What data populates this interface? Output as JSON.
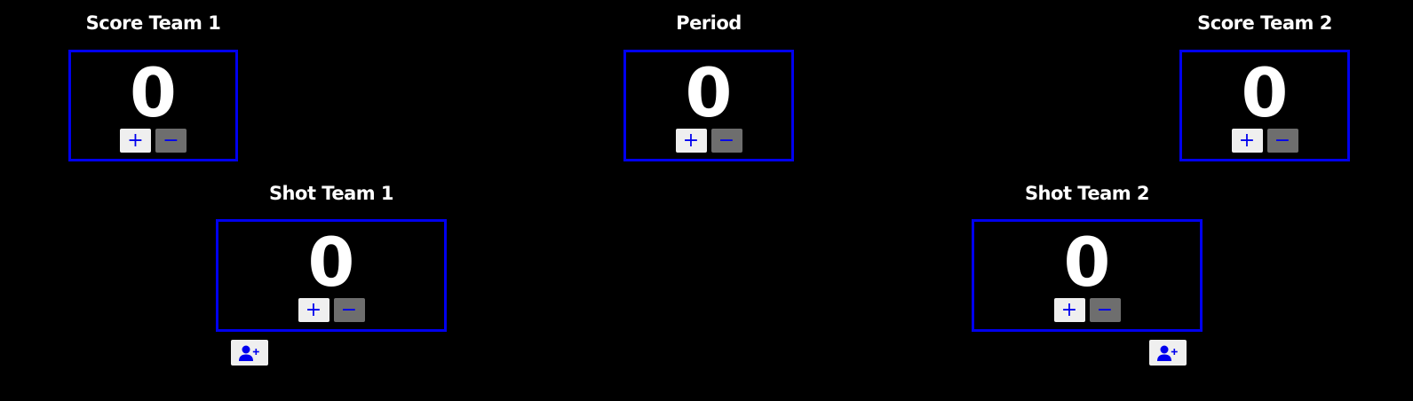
{
  "colors": {
    "background": "#000000",
    "accent_blue": "#0000ee",
    "text": "#ffffff",
    "plus_button_bg": "#efefef",
    "minus_button_bg": "#6e6e6e"
  },
  "score_team_1": {
    "title": "Score Team 1",
    "value": "0",
    "plus_label": "+",
    "minus_label": "−"
  },
  "period": {
    "title": "Period",
    "value": "0",
    "plus_label": "+",
    "minus_label": "−"
  },
  "score_team_2": {
    "title": "Score Team 2",
    "value": "0",
    "plus_label": "+",
    "minus_label": "−"
  },
  "shot_team_1": {
    "title": "Shot Team 1",
    "value": "0",
    "plus_label": "+",
    "minus_label": "−",
    "add_icon": "user-plus-icon"
  },
  "shot_team_2": {
    "title": "Shot Team 2",
    "value": "0",
    "plus_label": "+",
    "minus_label": "−",
    "add_icon": "user-plus-icon"
  }
}
